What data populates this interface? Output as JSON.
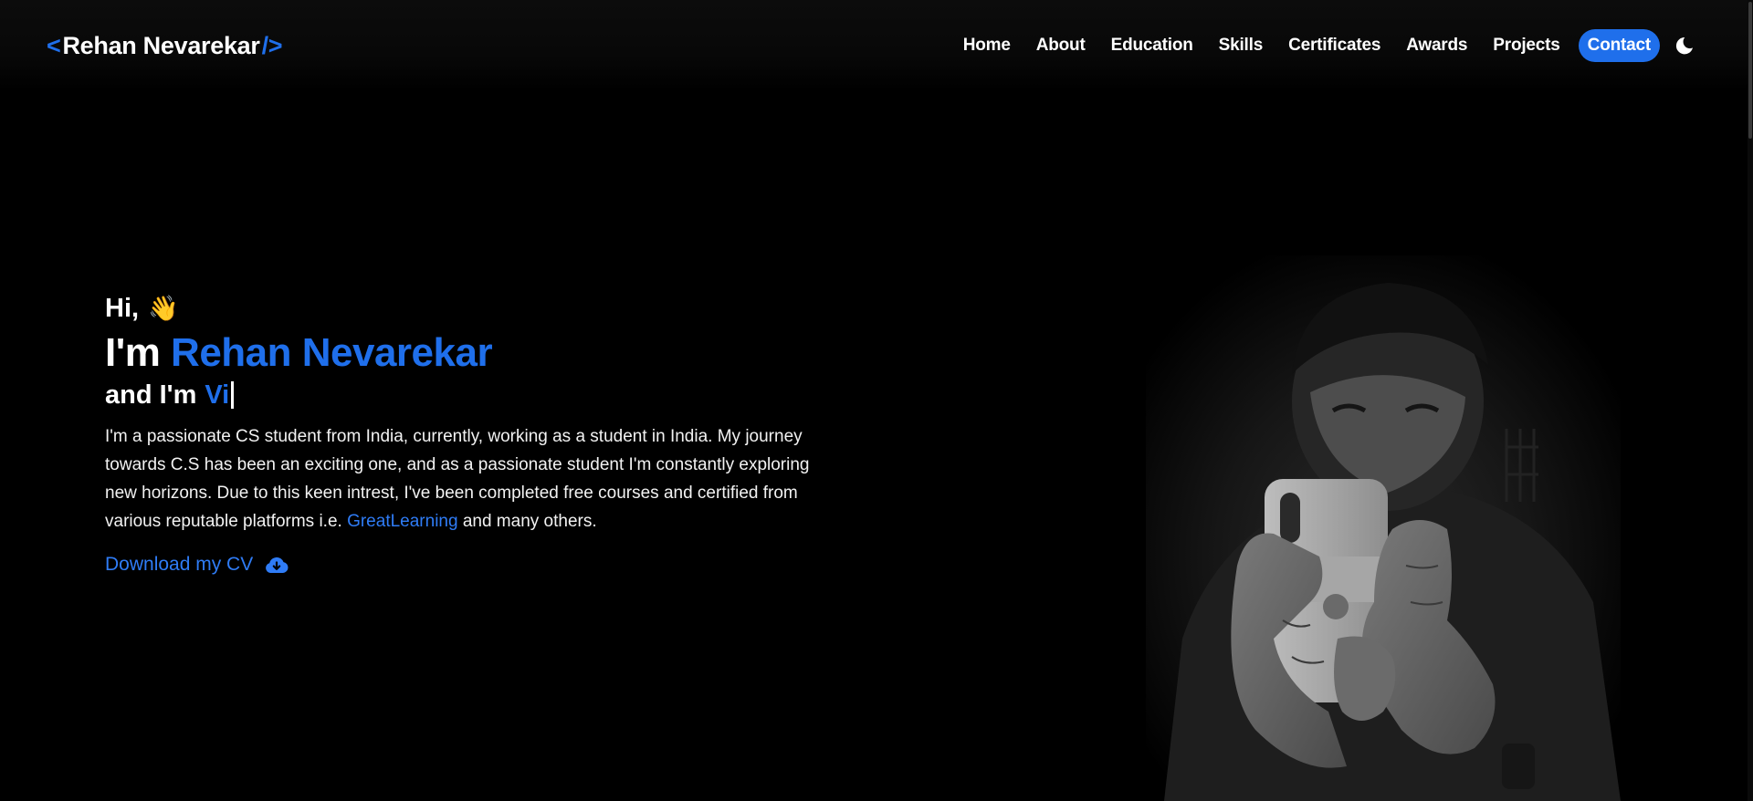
{
  "logo": {
    "open_bracket": "<",
    "name": "Rehan Nevarekar",
    "close_bracket": "/>"
  },
  "nav": {
    "items": [
      {
        "label": "Home"
      },
      {
        "label": "About"
      },
      {
        "label": "Education"
      },
      {
        "label": "Skills"
      },
      {
        "label": "Certificates"
      },
      {
        "label": "Awards"
      },
      {
        "label": "Projects"
      },
      {
        "label": "Contact"
      }
    ],
    "active": "Contact",
    "theme_icon": "moon-icon"
  },
  "hero": {
    "greeting": "Hi,",
    "wave_emoji": "👋",
    "im_prefix": "I'm",
    "name": "Rehan Nevarekar",
    "role_prefix": "and I'm",
    "role_typed": "Vi",
    "bio_before": "I'm a passionate CS student from India, currently, working as a student in India. My journey towards C.S has been an exciting one, and as a passionate student I'm constantly exploring new horizons. Due to this keen intrest, I've been completed free courses and certified from various reputable platforms i.e. ",
    "bio_link": "GreatLearning",
    "bio_after": " and many others.",
    "cv_label": "Download my CV",
    "cv_icon": "cloud-download-icon"
  },
  "colors": {
    "accent": "#1f6feb",
    "background": "#000000",
    "text": "#ffffff"
  }
}
